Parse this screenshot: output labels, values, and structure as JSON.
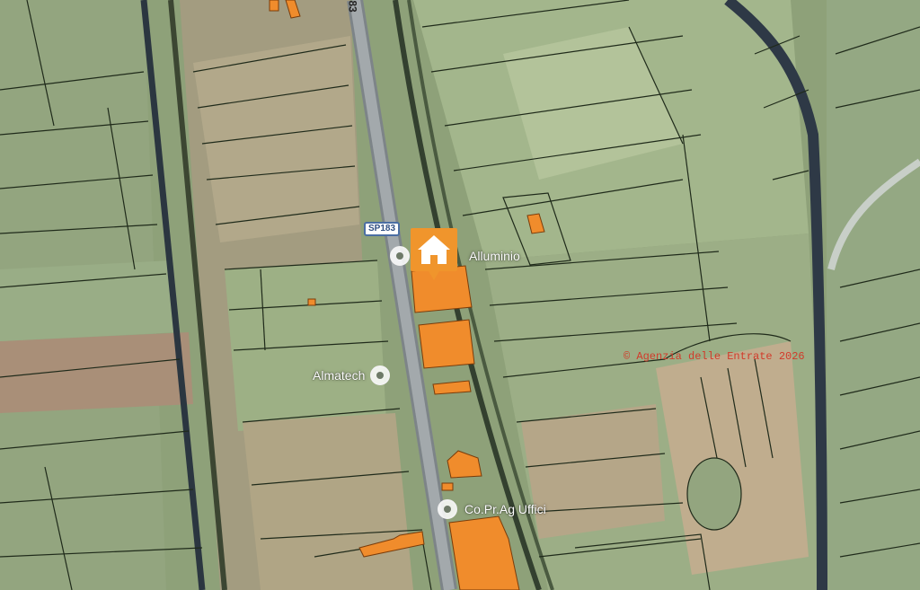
{
  "map": {
    "colors": {
      "field": "#8fa27a",
      "field_light": "#a9b895",
      "field_bare": "#b8a98c",
      "road": "#9aa0a4",
      "building": "#f08c2c",
      "parcel_line": "#1f2a1a",
      "canal": "#2b3640"
    },
    "road_number_top": "83",
    "road_shield": "SP183",
    "pois": [
      {
        "id": "alluminio",
        "label": "Alluminio",
        "icon": "place-marker-icon"
      },
      {
        "id": "almatech",
        "label": "Almatech",
        "icon": "place-marker-icon"
      },
      {
        "id": "copr",
        "label": "Co.Pr.Ag Uffici",
        "icon": "place-marker-icon"
      }
    ],
    "pin_icon": "home-icon",
    "watermark": "© Agenzia delle Entrate 2026"
  }
}
